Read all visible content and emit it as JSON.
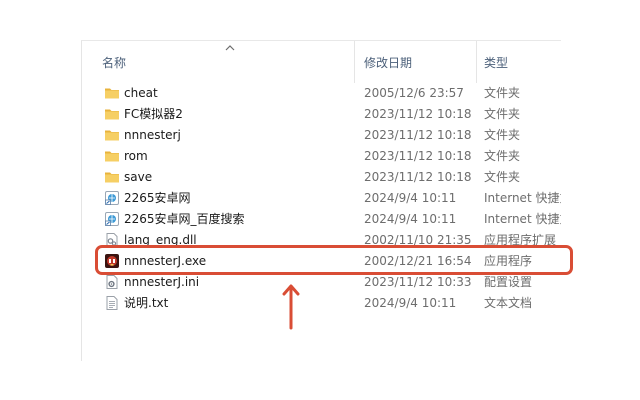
{
  "columns": {
    "name": "名称",
    "date": "修改日期",
    "type": "类型"
  },
  "files": [
    {
      "name": "cheat",
      "date": "2005/12/6 23:57",
      "type": "文件夹",
      "icon": "folder-icon"
    },
    {
      "name": "FC模拟器2",
      "date": "2023/11/12 10:18",
      "type": "文件夹",
      "icon": "folder-icon"
    },
    {
      "name": "nnnesterj",
      "date": "2023/11/12 10:18",
      "type": "文件夹",
      "icon": "folder-icon"
    },
    {
      "name": "rom",
      "date": "2023/11/12 10:18",
      "type": "文件夹",
      "icon": "folder-icon"
    },
    {
      "name": "save",
      "date": "2023/11/12 10:18",
      "type": "文件夹",
      "icon": "folder-icon"
    },
    {
      "name": "2265安卓网",
      "date": "2024/9/4 10:11",
      "type": "Internet 快捷方",
      "icon": "internet-shortcut-icon"
    },
    {
      "name": "2265安卓网_百度搜索",
      "date": "2024/9/4 10:11",
      "type": "Internet 快捷方",
      "icon": "internet-shortcut-icon"
    },
    {
      "name": "lang_eng.dll",
      "date": "2002/11/10 21:35",
      "type": "应用程序扩展",
      "icon": "dll-file-icon"
    },
    {
      "name": "nnnesterJ.exe",
      "date": "2002/12/21 16:54",
      "type": "应用程序",
      "icon": "exe-app-icon"
    },
    {
      "name": "nnnesterJ.ini",
      "date": "2023/11/12 10:33",
      "type": "配置设置",
      "icon": "ini-settings-icon"
    },
    {
      "name": "说明.txt",
      "date": "2024/9/4 10:11",
      "type": "文本文档",
      "icon": "text-document-icon"
    }
  ],
  "colors": {
    "annotation": "#d94d35",
    "folder": "#f4c85a",
    "header_text": "#4c607a"
  }
}
